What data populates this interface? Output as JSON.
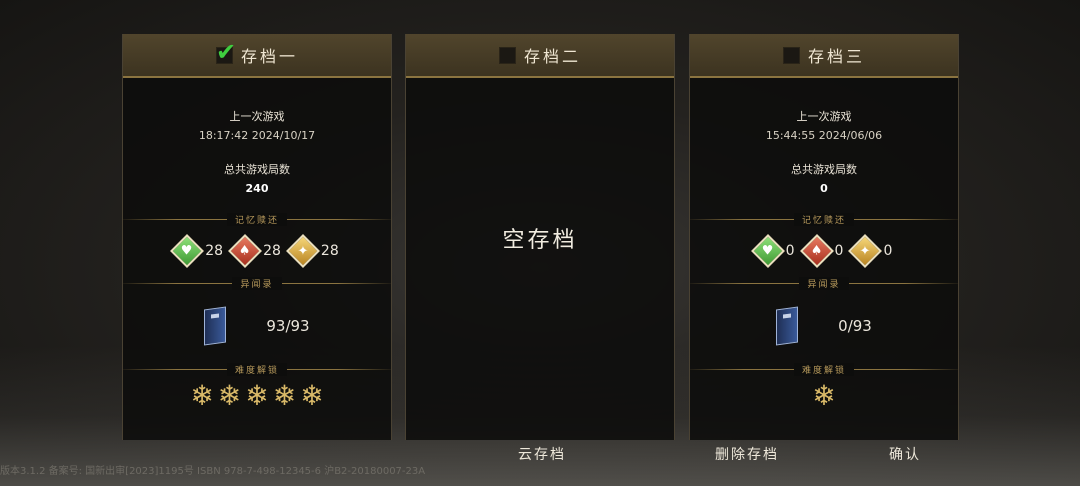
{
  "slots": [
    {
      "title": "存档一",
      "checked": true,
      "last_play_label": "上一次游戏",
      "last_play_time": "18:17:42 2024/10/17",
      "total_label": "总共游戏局数",
      "total_value": "240",
      "memory_label": "记忆赎还",
      "gems": [
        "28",
        "28",
        "28"
      ],
      "codex_label": "异闻录",
      "codex_value": "93/93",
      "difficulty_label": "难度解锁",
      "difficulty_unlocked": 5
    },
    {
      "title": "存档二",
      "checked": false,
      "empty_text": "空存档"
    },
    {
      "title": "存档三",
      "checked": false,
      "last_play_label": "上一次游戏",
      "last_play_time": "15:44:55 2024/06/06",
      "total_label": "总共游戏局数",
      "total_value": "0",
      "memory_label": "记忆赎还",
      "gems": [
        "0",
        "0",
        "0"
      ],
      "codex_label": "异闻录",
      "codex_value": "0/93",
      "difficulty_label": "难度解锁",
      "difficulty_unlocked": 1
    }
  ],
  "buttons": {
    "cloud_save": "云存档",
    "delete_save": "删除存档",
    "confirm": "确认"
  },
  "version_text": "版本3.1.2 备案号: 国新出审[2023]1195号 ISBN 978-7-498-12345-6 沪B2-20180007-23A",
  "icons": {
    "check": "check-icon",
    "gem_green": "heart-gem-icon",
    "gem_red": "red-gem-icon",
    "gem_gold": "gold-gem-icon",
    "book": "codex-book-icon",
    "flake": "difficulty-flake-icon"
  },
  "colors": {
    "header": "#4a3f28",
    "accent_gold": "#8b7440",
    "check_green": "#3fce3f"
  }
}
